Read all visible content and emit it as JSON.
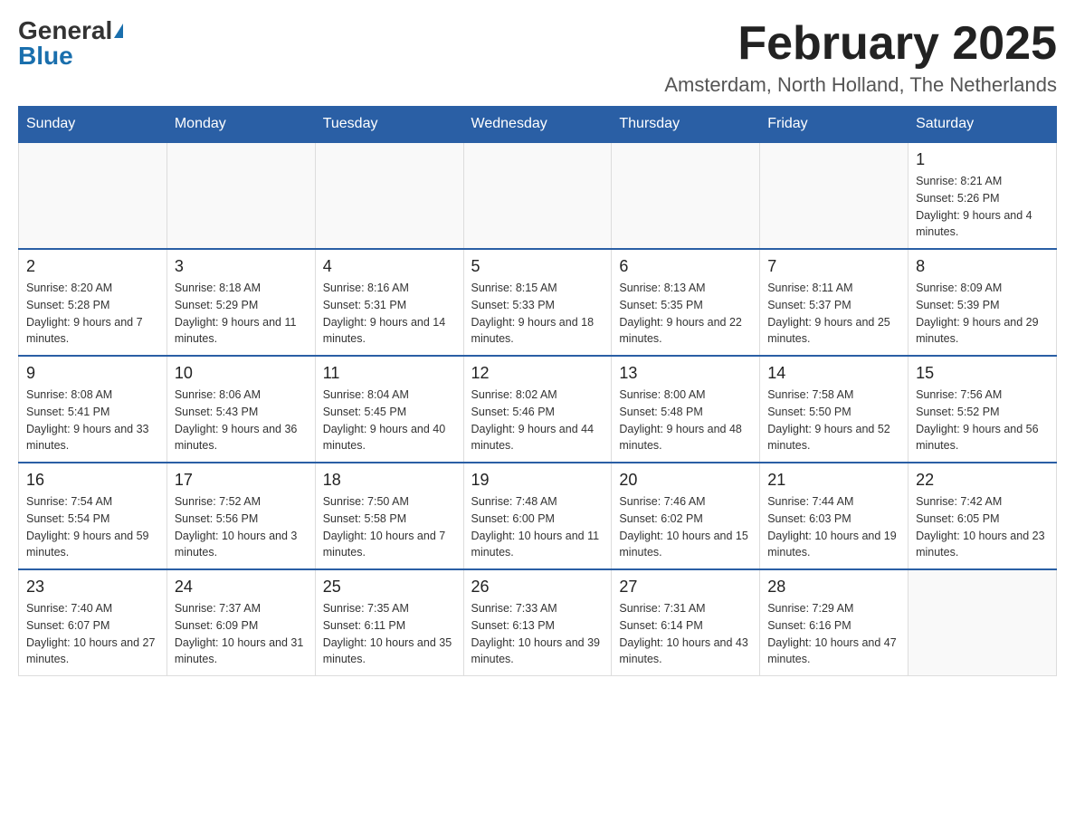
{
  "logo": {
    "general": "General",
    "blue": "Blue"
  },
  "title": "February 2025",
  "subtitle": "Amsterdam, North Holland, The Netherlands",
  "days_of_week": [
    "Sunday",
    "Monday",
    "Tuesday",
    "Wednesday",
    "Thursday",
    "Friday",
    "Saturday"
  ],
  "weeks": [
    [
      {
        "day": "",
        "info": ""
      },
      {
        "day": "",
        "info": ""
      },
      {
        "day": "",
        "info": ""
      },
      {
        "day": "",
        "info": ""
      },
      {
        "day": "",
        "info": ""
      },
      {
        "day": "",
        "info": ""
      },
      {
        "day": "1",
        "info": "Sunrise: 8:21 AM\nSunset: 5:26 PM\nDaylight: 9 hours and 4 minutes."
      }
    ],
    [
      {
        "day": "2",
        "info": "Sunrise: 8:20 AM\nSunset: 5:28 PM\nDaylight: 9 hours and 7 minutes."
      },
      {
        "day": "3",
        "info": "Sunrise: 8:18 AM\nSunset: 5:29 PM\nDaylight: 9 hours and 11 minutes."
      },
      {
        "day": "4",
        "info": "Sunrise: 8:16 AM\nSunset: 5:31 PM\nDaylight: 9 hours and 14 minutes."
      },
      {
        "day": "5",
        "info": "Sunrise: 8:15 AM\nSunset: 5:33 PM\nDaylight: 9 hours and 18 minutes."
      },
      {
        "day": "6",
        "info": "Sunrise: 8:13 AM\nSunset: 5:35 PM\nDaylight: 9 hours and 22 minutes."
      },
      {
        "day": "7",
        "info": "Sunrise: 8:11 AM\nSunset: 5:37 PM\nDaylight: 9 hours and 25 minutes."
      },
      {
        "day": "8",
        "info": "Sunrise: 8:09 AM\nSunset: 5:39 PM\nDaylight: 9 hours and 29 minutes."
      }
    ],
    [
      {
        "day": "9",
        "info": "Sunrise: 8:08 AM\nSunset: 5:41 PM\nDaylight: 9 hours and 33 minutes."
      },
      {
        "day": "10",
        "info": "Sunrise: 8:06 AM\nSunset: 5:43 PM\nDaylight: 9 hours and 36 minutes."
      },
      {
        "day": "11",
        "info": "Sunrise: 8:04 AM\nSunset: 5:45 PM\nDaylight: 9 hours and 40 minutes."
      },
      {
        "day": "12",
        "info": "Sunrise: 8:02 AM\nSunset: 5:46 PM\nDaylight: 9 hours and 44 minutes."
      },
      {
        "day": "13",
        "info": "Sunrise: 8:00 AM\nSunset: 5:48 PM\nDaylight: 9 hours and 48 minutes."
      },
      {
        "day": "14",
        "info": "Sunrise: 7:58 AM\nSunset: 5:50 PM\nDaylight: 9 hours and 52 minutes."
      },
      {
        "day": "15",
        "info": "Sunrise: 7:56 AM\nSunset: 5:52 PM\nDaylight: 9 hours and 56 minutes."
      }
    ],
    [
      {
        "day": "16",
        "info": "Sunrise: 7:54 AM\nSunset: 5:54 PM\nDaylight: 9 hours and 59 minutes."
      },
      {
        "day": "17",
        "info": "Sunrise: 7:52 AM\nSunset: 5:56 PM\nDaylight: 10 hours and 3 minutes."
      },
      {
        "day": "18",
        "info": "Sunrise: 7:50 AM\nSunset: 5:58 PM\nDaylight: 10 hours and 7 minutes."
      },
      {
        "day": "19",
        "info": "Sunrise: 7:48 AM\nSunset: 6:00 PM\nDaylight: 10 hours and 11 minutes."
      },
      {
        "day": "20",
        "info": "Sunrise: 7:46 AM\nSunset: 6:02 PM\nDaylight: 10 hours and 15 minutes."
      },
      {
        "day": "21",
        "info": "Sunrise: 7:44 AM\nSunset: 6:03 PM\nDaylight: 10 hours and 19 minutes."
      },
      {
        "day": "22",
        "info": "Sunrise: 7:42 AM\nSunset: 6:05 PM\nDaylight: 10 hours and 23 minutes."
      }
    ],
    [
      {
        "day": "23",
        "info": "Sunrise: 7:40 AM\nSunset: 6:07 PM\nDaylight: 10 hours and 27 minutes."
      },
      {
        "day": "24",
        "info": "Sunrise: 7:37 AM\nSunset: 6:09 PM\nDaylight: 10 hours and 31 minutes."
      },
      {
        "day": "25",
        "info": "Sunrise: 7:35 AM\nSunset: 6:11 PM\nDaylight: 10 hours and 35 minutes."
      },
      {
        "day": "26",
        "info": "Sunrise: 7:33 AM\nSunset: 6:13 PM\nDaylight: 10 hours and 39 minutes."
      },
      {
        "day": "27",
        "info": "Sunrise: 7:31 AM\nSunset: 6:14 PM\nDaylight: 10 hours and 43 minutes."
      },
      {
        "day": "28",
        "info": "Sunrise: 7:29 AM\nSunset: 6:16 PM\nDaylight: 10 hours and 47 minutes."
      },
      {
        "day": "",
        "info": ""
      }
    ]
  ]
}
